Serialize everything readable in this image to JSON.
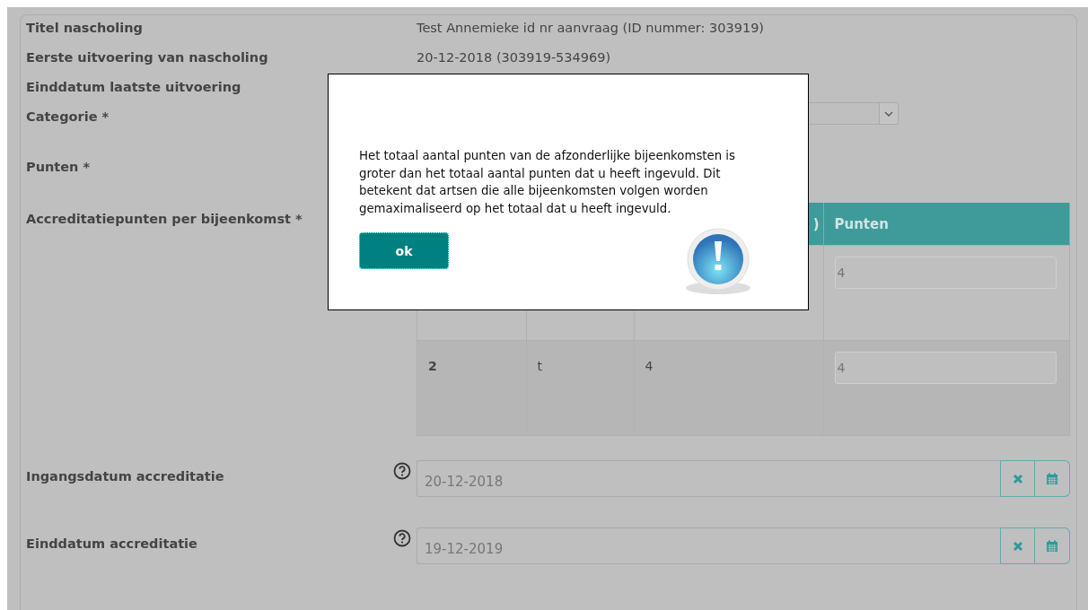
{
  "details": [
    {
      "label": "Titel nascholing",
      "value": "Test Annemieke id nr aanvraag (ID nummer: 303919)"
    },
    {
      "label": "Eerste uitvoering van nascholing",
      "value": "20-12-2018 (303919-534969)"
    },
    {
      "label": "Einddatum laatste uitvoering"
    }
  ],
  "category": {
    "label": "Categorie *"
  },
  "points": {
    "label": "Punten *"
  },
  "accreditation": {
    "label": "Accreditatiepunten per bijeenkomst *",
    "table": {
      "columns": [
        ")",
        "Punten"
      ],
      "rows": [
        {
          "points_input": "4"
        },
        {
          "column_1": "2",
          "column_2": "t",
          "column_3": "4",
          "points_input": "4"
        }
      ]
    }
  },
  "dates": [
    {
      "label": "Ingangsdatum accreditatie",
      "value": "20-12-2018"
    },
    {
      "label": "Einddatum accreditatie",
      "value": "19-12-2019"
    }
  ],
  "dialog": {
    "message": "Het totaal aantal punten van de afzonderlijke bijeenkomsten is groter dan het totaal aantal punten dat u heeft ingevuld. Dit betekent dat artsen die alle bijeenkomsten volgen worden gemaximaliseerd op het totaal dat u heeft ingevuld.",
    "button": "ok"
  }
}
